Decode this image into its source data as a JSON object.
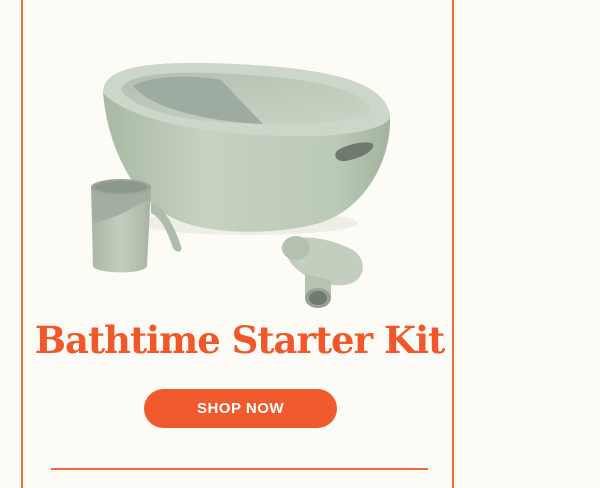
{
  "product": {
    "title": "Bathtime Starter Kit",
    "image_alt": "Sage green baby bathtub with cup and spout accessories"
  },
  "cta": {
    "label": "SHOP NOW"
  },
  "colors": {
    "accent": "#f05a2d",
    "border": "#f06a3c",
    "background": "#fcfbf5",
    "product_green": "#b9c6b5"
  }
}
